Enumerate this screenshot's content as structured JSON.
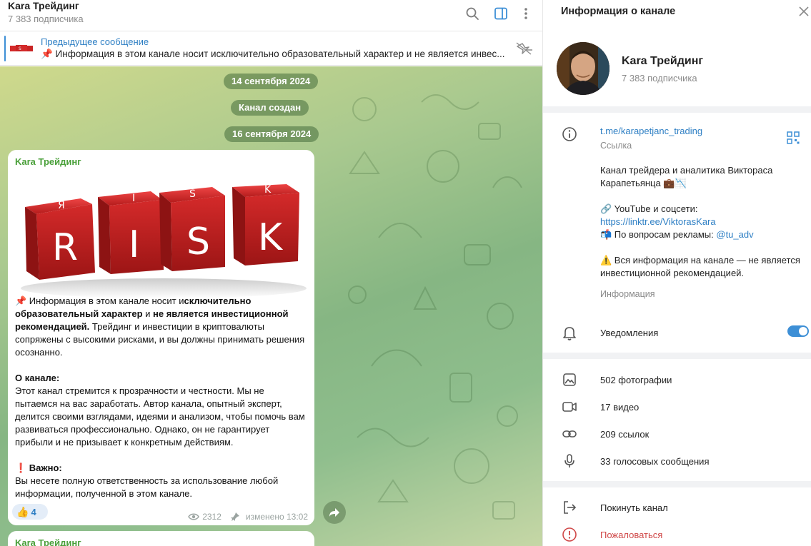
{
  "chat_header": {
    "title": "Kara Трейдинг",
    "subscribers": "7 383 подписчика"
  },
  "pinned": {
    "title": "Предыдущее сообщение",
    "text": "📌 Информация в этом канале носит исключительно образовательный характер и не является инвес..."
  },
  "dates": {
    "d1": "14 сентября 2024",
    "created": "Канал создан",
    "d2": "16 сентября 2024"
  },
  "message": {
    "author": "Kara Трейдинг",
    "image_letters": [
      "R",
      "I",
      "S",
      "K"
    ],
    "p1_pre": "📌 Информация в этом канале носит и",
    "p1_b1": "сключительно образовательный характер",
    "p1_mid": " и ",
    "p1_b2": "не является инвестиционной рекомендацией.",
    "p1_post": " Трейдинг и инвестиции в криптовалюты сопряжены с высокими рисками, и вы должны принимать решения осознанно.",
    "about_title": "О канале:",
    "about_text": "Этот канал стремится к прозрачности и честности. Мы не пытаемся на вас заработать. Автор канала, опытный эксперт, делится своими взглядами, идеями и анализом, чтобы помочь вам развиваться профессионально. Однако, он не гарантирует прибыли и не призывает к конкретным действиям.",
    "important_title": "❗ Важно:",
    "important_text": "Вы несете полную ответственность за использование любой информации, полученной в этом канале.",
    "reaction_emoji": "👍",
    "reaction_count": "4",
    "views": "2312",
    "edited": "изменено 13:02"
  },
  "message2": {
    "author": "Kara Трейдинг"
  },
  "info": {
    "title": "Информация о канале",
    "name": "Kara Трейдинг",
    "subscribers": "7 383 подписчика",
    "link": "t.me/karapetjanc_trading",
    "link_label": "Ссылка",
    "desc_line1": "Канал трейдера и аналитика Виктораса Карапетьянца 💼📉",
    "desc_line2": "🔗 YouTube и соцсети:",
    "desc_link": "https://linktr.ee/ViktorasKara",
    "desc_line3": "📬 По вопросам рекламы: ",
    "desc_ads": "@tu_adv",
    "desc_line4": "⚠️ Вся информация на канале — не является инвестиционной рекомендацией.",
    "desc_label": "Информация",
    "notifications": "Уведомления",
    "notifications_on": true,
    "photos": "502 фотографии",
    "videos": "17 видео",
    "links": "209 ссылок",
    "voice": "33 голосовых сообщения",
    "leave": "Покинуть канал",
    "report": "Пожаловаться"
  },
  "colors": {
    "accent": "#2e7fc4",
    "author": "#4aa03a",
    "danger": "#d04848",
    "risk_red": "#d42a2a"
  }
}
